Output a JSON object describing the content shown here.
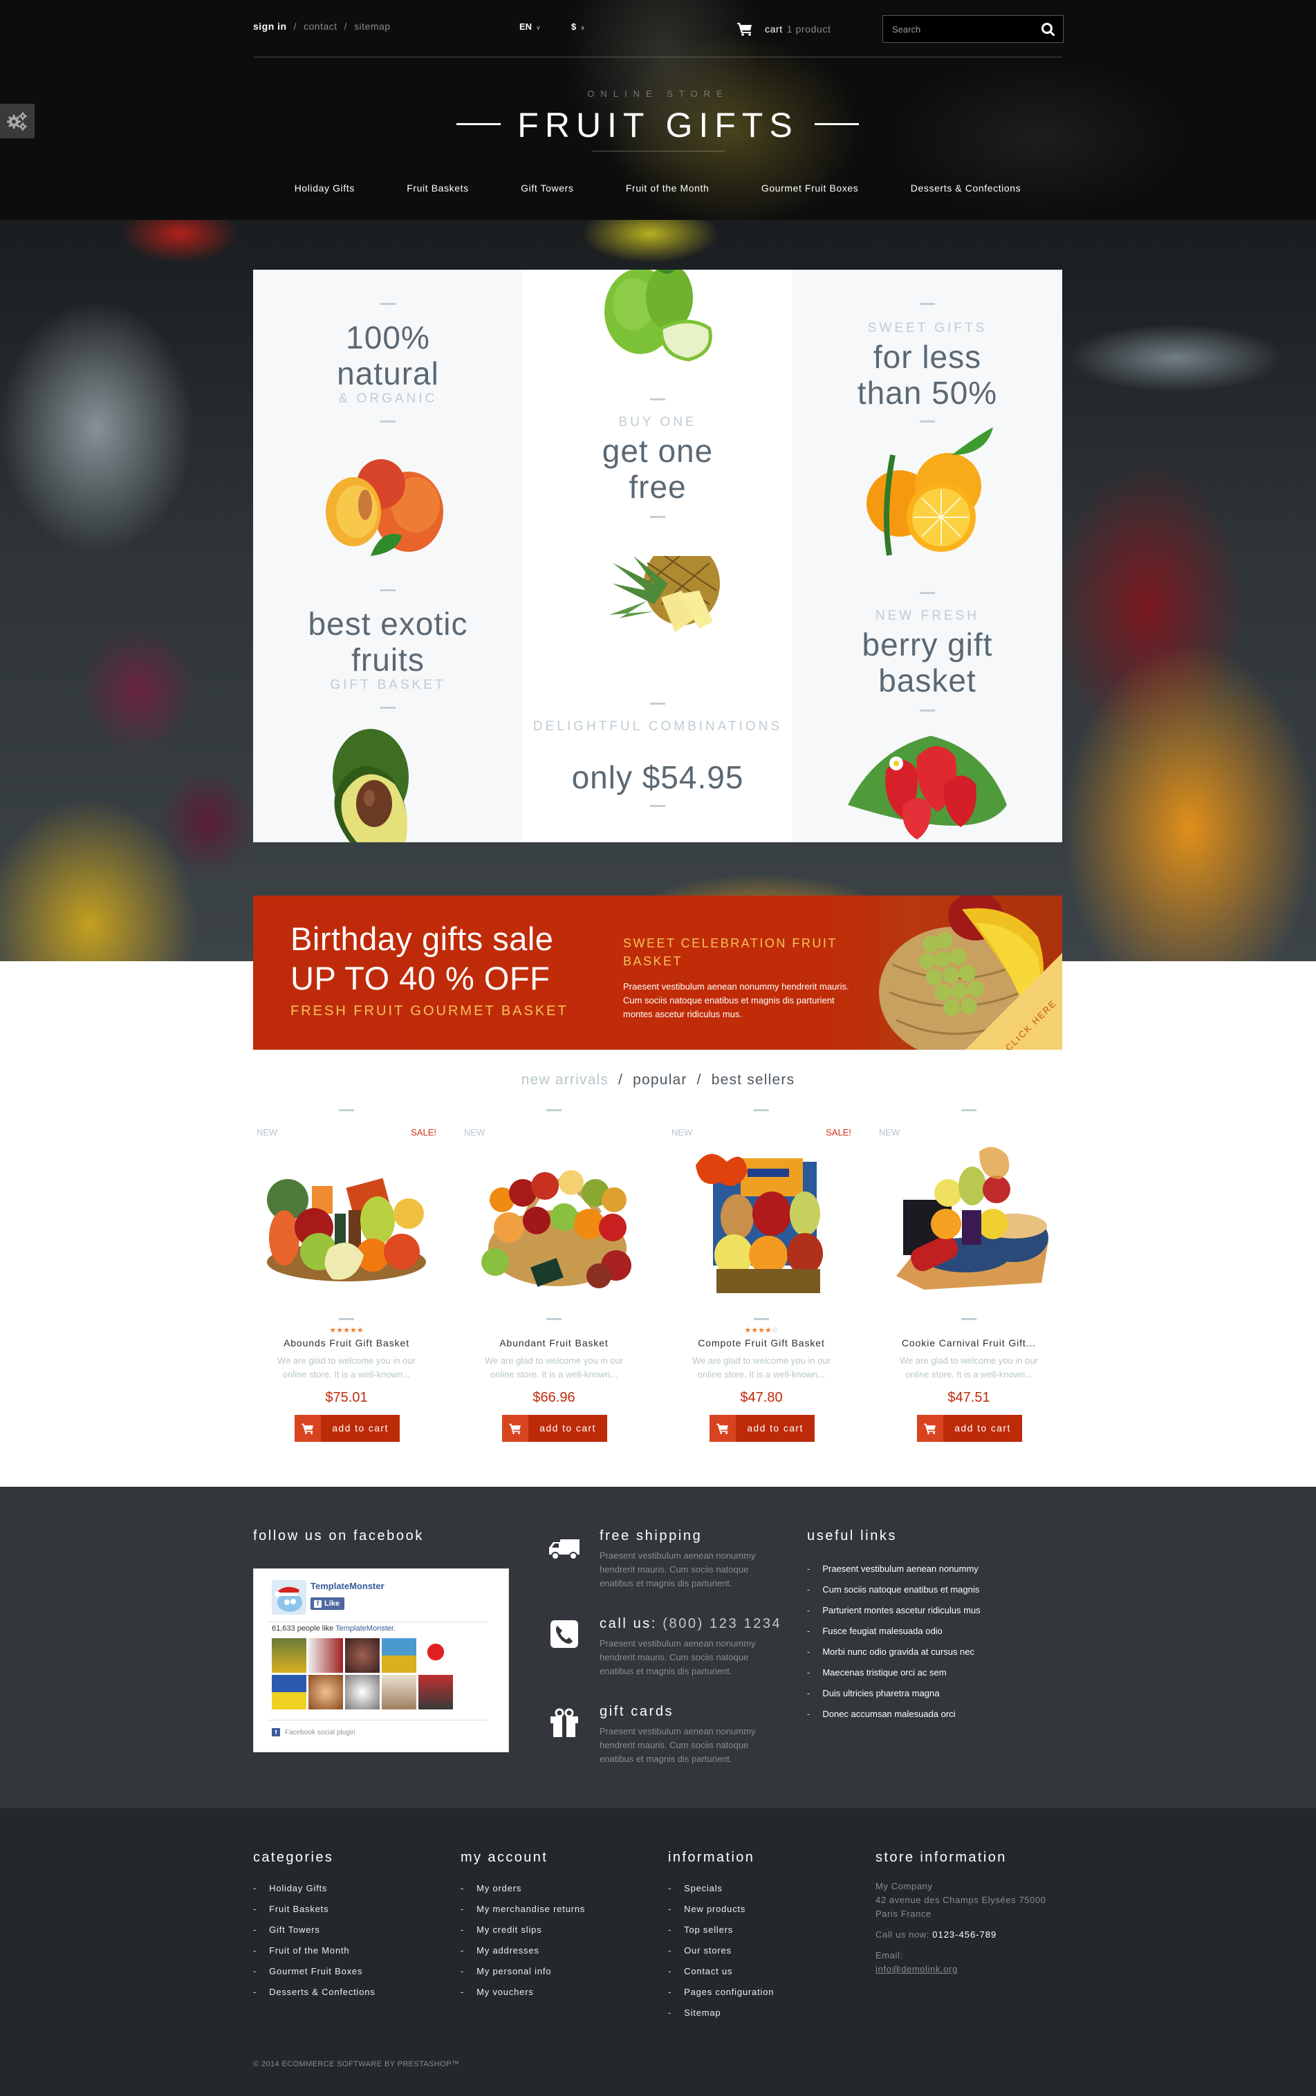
{
  "colors": {
    "accent_red": "#bd2a08",
    "price_red": "#c0290a",
    "gold": "#f5c25a",
    "muted_blue_gray": "#b7c6cd",
    "dark_footer_1": "#33363a",
    "dark_footer_2": "#25282b",
    "star_orange": "#f07b2b"
  },
  "topbar": {
    "links": [
      {
        "label": "sign in",
        "active": true
      },
      {
        "label": "contact",
        "active": false
      },
      {
        "label": "sitemap",
        "active": false
      }
    ],
    "separator": "/",
    "language": "EN",
    "currency": "$",
    "cart_label": "cart",
    "cart_count": "1 product",
    "search_placeholder": "Search",
    "icons": {
      "cart": "cart-icon",
      "search": "search-icon",
      "dropdown": "chevron-down-icon",
      "settings": "gears-icon"
    }
  },
  "brand": {
    "subtitle": "ONLINE STORE",
    "title": "FRUIT GIFTS"
  },
  "nav": {
    "items": [
      "Holiday Gifts",
      "Fruit Baskets",
      "Gift Towers",
      "Fruit of the Month",
      "Gourmet Fruit Boxes",
      "Desserts & Confections"
    ]
  },
  "promos": [
    {
      "kind": "text",
      "lines": [
        "100%",
        "natural"
      ],
      "kicker_after": "& ORGANIC"
    },
    {
      "kind": "image",
      "fruit": "green-apple"
    },
    {
      "kind": "text",
      "kicker_before": "SWEET GIFTS",
      "lines": [
        "for less",
        "than 50%"
      ]
    },
    {
      "kind": "image",
      "fruit": "peach"
    },
    {
      "kind": "text",
      "kicker_before": "BUY ONE",
      "lines": [
        "get one",
        "free"
      ]
    },
    {
      "kind": "image",
      "fruit": "orange"
    },
    {
      "kind": "text",
      "lines": [
        "best exotic",
        "fruits"
      ],
      "kicker_after": "GIFT BASKET"
    },
    {
      "kind": "image",
      "fruit": "pineapple"
    },
    {
      "kind": "text",
      "kicker_before": "NEW FRESH",
      "lines": [
        "berry gift",
        "basket"
      ]
    },
    {
      "kind": "image",
      "fruit": "avocado"
    },
    {
      "kind": "text",
      "kicker_before": "DELIGHTFUL COMBINATIONS",
      "lines": [
        "only $54.95"
      ]
    },
    {
      "kind": "image",
      "fruit": "strawberry"
    }
  ],
  "banner": {
    "headline_1": "Birthday gifts sale",
    "headline_2": "UP TO 40 % OFF",
    "tagline": "FRESH FRUIT GOURMET BASKET",
    "kicker": "SWEET CELEBRATION FRUIT BASKET",
    "body": "Praesent vestibulum aenean nonummy hendrerit mauris. Cum sociis natoque enatibus et magnis dis parturient montes ascetur ridiculus mus.",
    "corner_label": "CLICK HERE"
  },
  "tabs": {
    "items": [
      {
        "label": "new arrivals",
        "active": false
      },
      {
        "label": "popular",
        "active": true
      },
      {
        "label": "best sellers",
        "active": true
      }
    ],
    "separator": "/"
  },
  "products": [
    {
      "name": "Abounds Fruit Gift Basket",
      "badge_new": "NEW",
      "badge_sale": "SALE!",
      "rating": 5,
      "rating_max": 5,
      "description": "We are glad to welcome you in our online store. It is a well-known...",
      "price": "$75.01",
      "button": "add to cart"
    },
    {
      "name": "Abundant Fruit Basket",
      "badge_new": "NEW",
      "badge_sale": "",
      "rating": 0,
      "rating_max": 5,
      "description": "We are glad to welcome you in our online store. It is a well-known...",
      "price": "$66.96",
      "button": "add to cart"
    },
    {
      "name": "Compote Fruit Gift Basket",
      "badge_new": "NEW",
      "badge_sale": "SALE!",
      "rating": 4,
      "rating_max": 5,
      "description": "We are glad to welcome you in our online store. It is a well-known...",
      "price": "$47.80",
      "button": "add to cart"
    },
    {
      "name": "Cookie Carnival Fruit Gift...",
      "badge_new": "NEW",
      "badge_sale": "",
      "rating": 0,
      "rating_max": 5,
      "description": "We are glad to welcome you in our online store. It is a well-known...",
      "price": "$47.51",
      "button": "add to cart"
    }
  ],
  "facebook": {
    "heading": "follow us on facebook",
    "page_name": "TemplateMonster",
    "like_label": "Like",
    "count_text": "61,633 people like",
    "count_link": "TemplateMonster.",
    "plugin_label": "Facebook social plugin"
  },
  "features": [
    {
      "icon": "truck-icon",
      "title": "free shipping",
      "title_extra": "",
      "text": "Praesent vestibulum aenean nonummy hendrerit mauris. Cum sociis natoque enatibus et magnis dis parturient."
    },
    {
      "icon": "phone-icon",
      "title": "call us:",
      "title_extra": "(800) 123 1234",
      "text": "Praesent vestibulum aenean nonummy hendrerit mauris. Cum sociis natoque enatibus et magnis dis parturient."
    },
    {
      "icon": "gift-icon",
      "title": "gift cards",
      "title_extra": "",
      "text": "Praesent vestibulum aenean nonummy hendrerit mauris. Cum sociis natoque enatibus et magnis dis parturient."
    }
  ],
  "useful_links": {
    "heading": "useful links",
    "items": [
      "Praesent vestibulum aenean nonummy",
      "Cum sociis natoque enatibus et magnis",
      "Parturient montes ascetur ridiculus mus",
      "Fusce feugiat malesuada odio",
      "Morbi nunc odio gravida at cursus nec",
      "Maecenas tristique orci ac sem",
      "Duis ultricies pharetra magna",
      "Donec accumsan malesuada orci"
    ]
  },
  "footer": {
    "categories": {
      "heading": "categories",
      "items": [
        "Holiday Gifts",
        "Fruit Baskets",
        "Gift Towers",
        "Fruit of the Month",
        "Gourmet Fruit Boxes",
        "Desserts & Confections"
      ]
    },
    "account": {
      "heading": "my account",
      "items": [
        "My orders",
        "My merchandise returns",
        "My credit slips",
        "My addresses",
        "My personal info",
        "My vouchers"
      ]
    },
    "information": {
      "heading": "information",
      "items": [
        "Specials",
        "New products",
        "Top sellers",
        "Our stores",
        "Contact us",
        "Pages configuration",
        "Sitemap"
      ]
    },
    "store": {
      "heading": "store information",
      "company": "My Company",
      "address_1": "42 avenue des Champs Elysées 75000",
      "address_2": "Paris France",
      "call_label": "Call us now:",
      "phone": "0123-456-789",
      "email_label": "Email:",
      "email": "info@demolink.org"
    },
    "copyright": "© 2014 ECOMMERCE SOFTWARE BY PRESTASHOP™"
  }
}
